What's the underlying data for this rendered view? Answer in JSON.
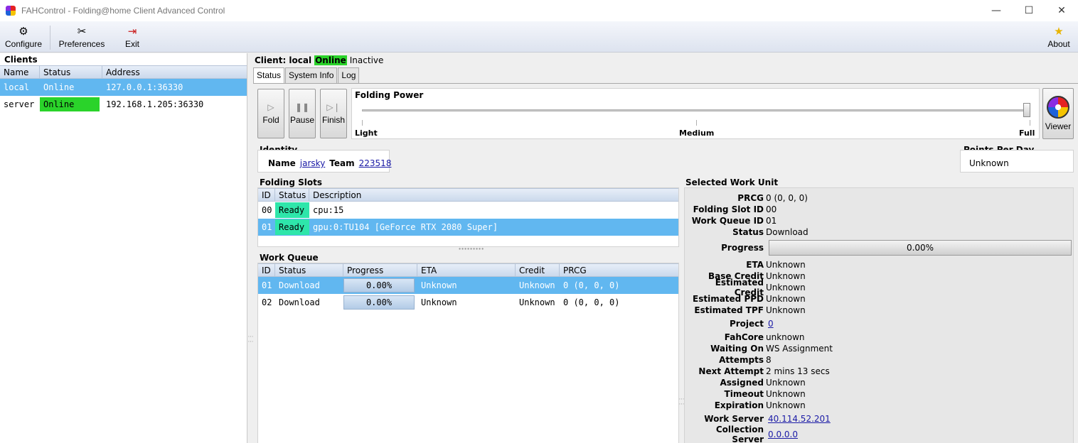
{
  "window": {
    "title": "FAHControl - Folding@home Client Advanced Control",
    "minimize": "—",
    "maximize": "☐",
    "close": "✕"
  },
  "toolbar": {
    "configure": "Configure",
    "preferences": "Preferences",
    "exit": "Exit",
    "about": "About"
  },
  "clients": {
    "title": "Clients",
    "headers": [
      "Name",
      "Status",
      "Address"
    ],
    "rows": [
      {
        "name": "local",
        "status": "Online",
        "address": "127.0.0.1:36330"
      },
      {
        "name": "server",
        "status": "Online",
        "address": "192.168.1.205:36330"
      }
    ]
  },
  "client_header": {
    "prefix": "Client: local",
    "status": "Online",
    "state": "Inactive"
  },
  "tabs": [
    "Status",
    "System Info",
    "Log"
  ],
  "controls": {
    "fold": "Fold",
    "pause": "Pause",
    "finish": "Finish",
    "viewer": "Viewer"
  },
  "folding_power": {
    "title": "Folding Power",
    "light": "Light",
    "medium": "Medium",
    "full": "Full",
    "level": 1.0
  },
  "identity": {
    "title": "Identity",
    "name_label": "Name",
    "name": "jarsky",
    "team_label": "Team",
    "team": "223518"
  },
  "ppd": {
    "title": "Points Per Day",
    "value": "Unknown"
  },
  "slots": {
    "title": "Folding Slots",
    "headers": [
      "ID",
      "Status",
      "Description"
    ],
    "rows": [
      {
        "id": "00",
        "status": "Ready",
        "description": "cpu:15"
      },
      {
        "id": "01",
        "status": "Ready",
        "description": "gpu:0:TU104 [GeForce RTX 2080 Super]"
      }
    ]
  },
  "work_queue": {
    "title": "Work Queue",
    "headers": [
      "ID",
      "Status",
      "Progress",
      "ETA",
      "Credit",
      "PRCG"
    ],
    "rows": [
      {
        "id": "01",
        "status": "Download",
        "progress": "0.00%",
        "eta": "Unknown",
        "credit": "Unknown",
        "prcg": "0 (0, 0, 0)"
      },
      {
        "id": "02",
        "status": "Download",
        "progress": "0.00%",
        "eta": "Unknown",
        "credit": "Unknown",
        "prcg": "0 (0, 0, 0)"
      }
    ]
  },
  "swu": {
    "title": "Selected Work Unit",
    "prcg_label": "PRCG",
    "prcg": "0 (0, 0, 0)",
    "slot_label": "Folding Slot ID",
    "slot": "00",
    "queue_label": "Work Queue ID",
    "queue": "01",
    "status_label": "Status",
    "status": "Download",
    "progress_label": "Progress",
    "progress": "0.00%",
    "eta_label": "ETA",
    "eta": "Unknown",
    "base_credit_label": "Base Credit",
    "base_credit": "Unknown",
    "est_credit_label": "Estimated Credit",
    "est_credit": "Unknown",
    "est_ppd_label": "Estimated PPD",
    "est_ppd": "Unknown",
    "est_tpf_label": "Estimated TPF",
    "est_tpf": "Unknown",
    "project_label": "Project",
    "project": "0",
    "fahcore_label": "FahCore",
    "fahcore": "unknown",
    "waiting_label": "Waiting On",
    "waiting": "WS Assignment",
    "attempts_label": "Attempts",
    "attempts": "8",
    "next_label": "Next Attempt",
    "next": "2 mins 13 secs",
    "assigned_label": "Assigned",
    "assigned": "Unknown",
    "timeout_label": "Timeout",
    "timeout": "Unknown",
    "expiration_label": "Expiration",
    "expiration": "Unknown",
    "ws_label": "Work Server",
    "ws": "40.114.52.201",
    "cs_label": "Collection Server",
    "cs": "0.0.0.0"
  }
}
